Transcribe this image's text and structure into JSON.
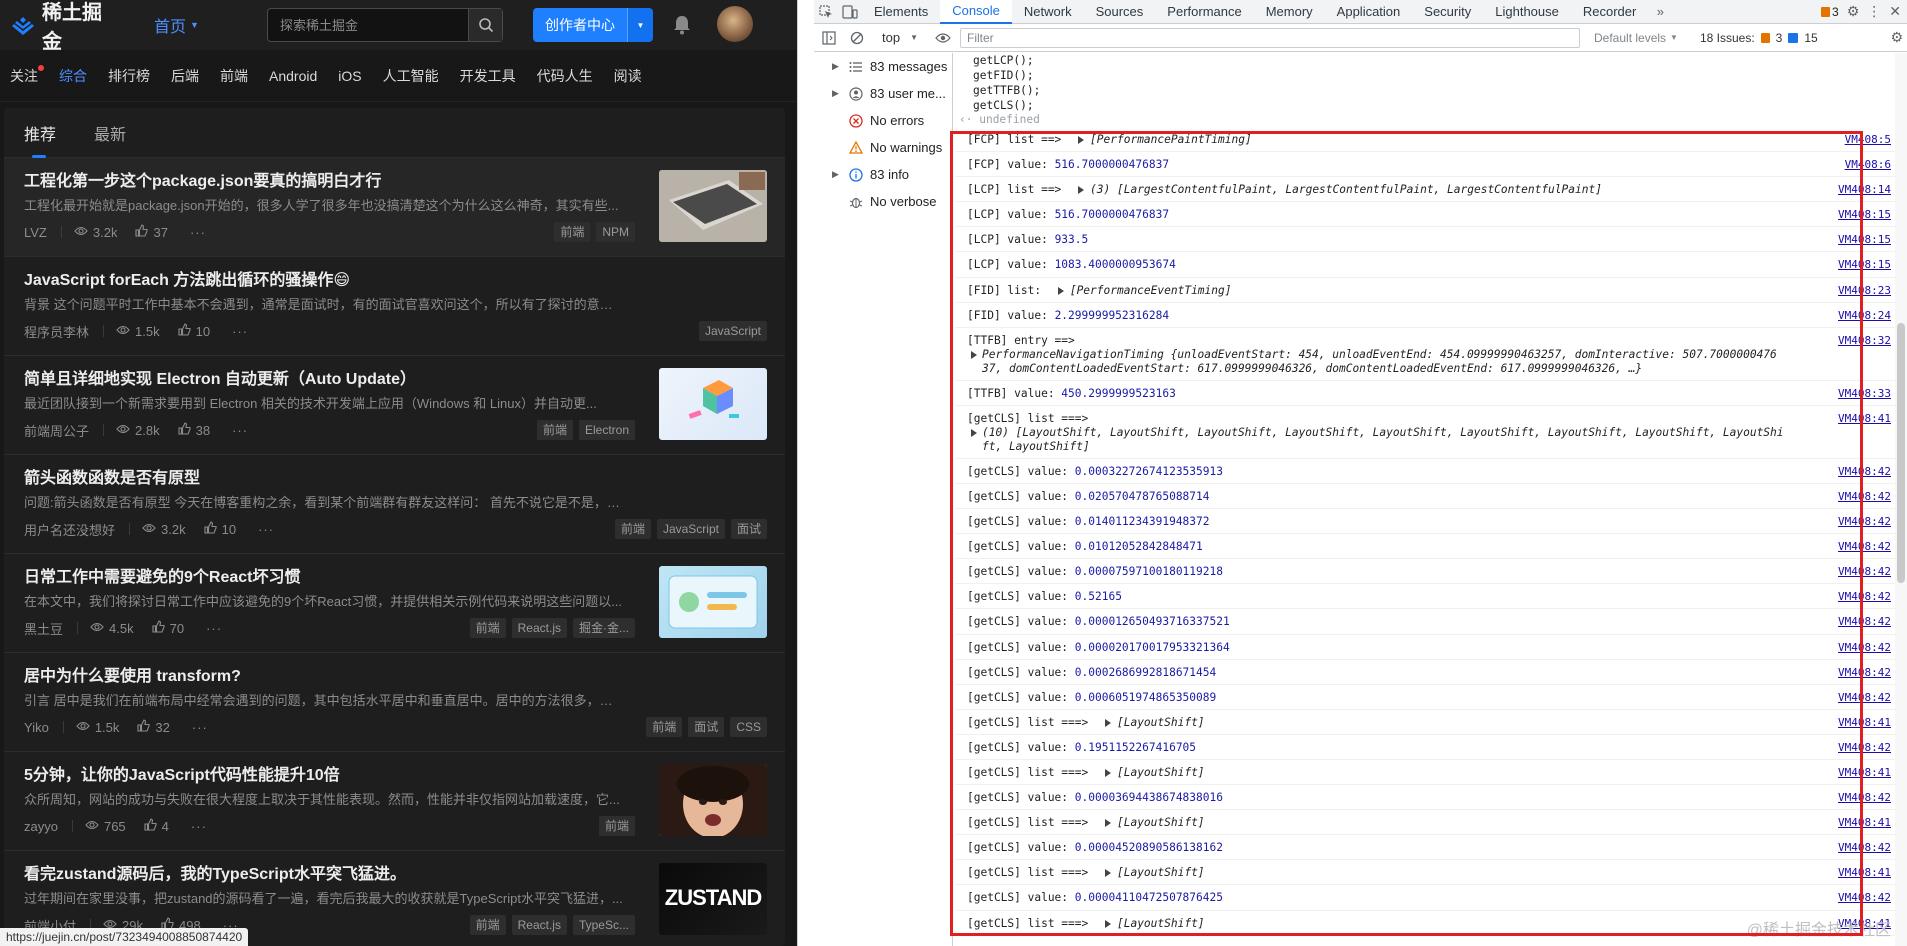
{
  "juejin": {
    "logo_text": "稀土掘金",
    "home_label": "首页",
    "search_placeholder": "探索稀土掘金",
    "creator_label": "创作者中心",
    "categories": [
      "关注",
      "综合",
      "排行榜",
      "后端",
      "前端",
      "Android",
      "iOS",
      "人工智能",
      "开发工具",
      "代码人生",
      "阅读"
    ],
    "feed_tabs": [
      "推荐",
      "最新"
    ],
    "articles": [
      {
        "title": "工程化第一步这个package.json要真的搞明白才行",
        "desc": "工程化最开始就是package.json开始的，很多人学了很多年也没搞清楚这个为什么这么神奇，其实有些...",
        "author": "LVZ",
        "views": "3.2k",
        "likes": "37",
        "tags": [
          "前端",
          "NPM"
        ],
        "thumb": true
      },
      {
        "title": "JavaScript forEach 方法跳出循环的骚操作😄",
        "desc": "背景 这个问题平时工作中基本不会遇到，通常是面试时，有的面试官喜欢问这个，所以有了探讨的意义。 首先我们来看看 for ...",
        "author": "程序员李林",
        "views": "1.5k",
        "likes": "10",
        "tags": [
          "JavaScript"
        ],
        "thumb": false
      },
      {
        "title": "简单且详细地实现 Electron 自动更新（Auto Update）",
        "desc": "最近团队接到一个新需求要用到 Electron 相关的技术开发端上应用（Windows 和 Linux）并自动更...",
        "author": "前端周公子",
        "views": "2.8k",
        "likes": "38",
        "tags": [
          "前端",
          "Electron"
        ],
        "thumb": true
      },
      {
        "title": "箭头函数函数是否有原型",
        "desc": "问题:箭头函数是否有原型 今天在博客重构之余，看到某个前端群有群友这样问： 首先不说它是不是，我们来回顾一下 箭头函数...",
        "author": "用户名还没想好",
        "views": "3.2k",
        "likes": "10",
        "tags": [
          "前端",
          "JavaScript",
          "面试"
        ],
        "thumb": false
      },
      {
        "title": "日常工作中需要避免的9个React坏习惯",
        "desc": "在本文中，我们将探讨日常工作中应该避免的9个坏React习惯，并提供相关示例代码来说明这些问题以...",
        "author": "黑土豆",
        "views": "4.5k",
        "likes": "70",
        "tags": [
          "前端",
          "React.js",
          "掘金·金..."
        ],
        "thumb": true
      },
      {
        "title": "居中为什么要使用 transform?",
        "desc": "引言 居中是我们在前端布局中经常会遇到的问题，其中包括水平居中和垂直居中。居中的方法很多，比如说水平居中可以使用...",
        "author": "Yiko",
        "views": "1.5k",
        "likes": "32",
        "tags": [
          "前端",
          "面试",
          "CSS"
        ],
        "thumb": false
      },
      {
        "title": "5分钟，让你的JavaScript代码性能提升10倍",
        "desc": "众所周知，网站的成功与失败在很大程度上取决于其性能表现。然而，性能并非仅指网站加载速度，它...",
        "author": "zayyo",
        "views": "765",
        "likes": "4",
        "tags": [
          "前端"
        ],
        "thumb": true
      },
      {
        "title": "看完zustand源码后，我的TypeScript水平突飞猛进。",
        "desc": "过年期间在家里没事，把zustand的源码看了一遍，看完后我最大的收获就是TypeScript水平突飞猛进，...",
        "author": "前端小付",
        "views": "29k",
        "likes": "498",
        "tags": [
          "前端",
          "React.js",
          "TypeSc..."
        ],
        "thumb": true,
        "thumb_text": "ZUSTAND"
      }
    ],
    "status_url": "https://juejin.cn/post/7323494008850874420"
  },
  "devtools": {
    "tabs": [
      "Elements",
      "Console",
      "Network",
      "Sources",
      "Performance",
      "Memory",
      "Application",
      "Security",
      "Lighthouse",
      "Recorder"
    ],
    "active_tab": "Console",
    "warn_badge": "3",
    "context": "top",
    "filter_placeholder": "Filter",
    "levels_label": "Default levels",
    "issues_label": "18 Issues:",
    "issues_warn": "3",
    "issues_info": "15",
    "sidebar": [
      {
        "label": "83 messages",
        "icon": "list-icon"
      },
      {
        "label": "83 user me...",
        "icon": "user-icon"
      },
      {
        "label": "No errors",
        "icon": "error-icon"
      },
      {
        "label": "No warnings",
        "icon": "warning-icon"
      },
      {
        "label": "83 info",
        "icon": "info-icon"
      },
      {
        "label": "No verbose",
        "icon": "bug-icon"
      }
    ],
    "pre_lines": [
      "getLCP();",
      "getFID();",
      "getTTFB();",
      "getCLS();"
    ],
    "undefined_line": "undefined",
    "logs": [
      {
        "prefix": "[FCP] list ==> ",
        "obj": "[PerformancePaintTiming]",
        "src": "VM408:5",
        "type": "obj"
      },
      {
        "prefix": "[FCP] value: ",
        "val": "516.7000000476837",
        "src": "VM408:6",
        "type": "num"
      },
      {
        "prefix": "[LCP] list ==> ",
        "obj": "(3) [LargestContentfulPaint, LargestContentfulPaint, LargestContentfulPaint]",
        "src": "VM408:14",
        "type": "obj"
      },
      {
        "prefix": "[LCP] value: ",
        "val": "516.7000000476837",
        "src": "VM408:15",
        "type": "num"
      },
      {
        "prefix": "[LCP] value: ",
        "val": "933.5",
        "src": "VM408:15",
        "type": "num"
      },
      {
        "prefix": "[LCP] value: ",
        "val": "1083.4000000953674",
        "src": "VM408:15",
        "type": "num"
      },
      {
        "prefix": "[FID] list: ",
        "obj": "[PerformanceEventTiming]",
        "src": "VM408:23",
        "type": "obj"
      },
      {
        "prefix": "[FID] value: ",
        "val": "2.299999952316284",
        "src": "VM408:24",
        "type": "num"
      },
      {
        "prefix": "[TTFB] entry ==>",
        "src": "VM408:32",
        "type": "ttfb",
        "line2": "PerformanceNavigationTiming {unloadEventStart: 454, unloadEventEnd: 454.09999990463257, domInteractive: 507.7000000476",
        "line3": "37, domContentLoadedEventStart: 617.0999999046326, domContentLoadedEventEnd: 617.0999999046326, …}"
      },
      {
        "prefix": "[TTFB] value: ",
        "val": "450.2999999523163",
        "src": "VM408:33",
        "type": "num"
      },
      {
        "prefix": "[getCLS] list ===>",
        "src": "VM408:41",
        "type": "cls",
        "line2": "(10) [LayoutShift, LayoutShift, LayoutShift, LayoutShift, LayoutShift, LayoutShift, LayoutShift, LayoutShift, LayoutShi",
        "line3": "ft, LayoutShift]"
      },
      {
        "prefix": "[getCLS] value: ",
        "val": "0.00032272674123535913",
        "src": "VM408:42",
        "type": "num"
      },
      {
        "prefix": "[getCLS] value: ",
        "val": "0.020570478765088714",
        "src": "VM408:42",
        "type": "num"
      },
      {
        "prefix": "[getCLS] value: ",
        "val": "0.014011234391948372",
        "src": "VM408:42",
        "type": "num"
      },
      {
        "prefix": "[getCLS] value: ",
        "val": "0.01012052842848471",
        "src": "VM408:42",
        "type": "num"
      },
      {
        "prefix": "[getCLS] value: ",
        "val": "0.00007597100180119218",
        "src": "VM408:42",
        "type": "num"
      },
      {
        "prefix": "[getCLS] value: ",
        "val": "0.52165",
        "src": "VM408:42",
        "type": "num"
      },
      {
        "prefix": "[getCLS] value: ",
        "val": "0.000012650493716337521",
        "src": "VM408:42",
        "type": "num"
      },
      {
        "prefix": "[getCLS] value: ",
        "val": "0.000020170017953321364",
        "src": "VM408:42",
        "type": "num"
      },
      {
        "prefix": "[getCLS] value: ",
        "val": "0.0002686992818671454",
        "src": "VM408:42",
        "type": "num"
      },
      {
        "prefix": "[getCLS] value: ",
        "val": "0.0006051974865350089",
        "src": "VM408:42",
        "type": "num"
      },
      {
        "prefix": "[getCLS] list ===> ",
        "obj": "[LayoutShift]",
        "src": "VM408:41",
        "type": "obj"
      },
      {
        "prefix": "[getCLS] value: ",
        "val": "0.1951152267416705",
        "src": "VM408:42",
        "type": "num"
      },
      {
        "prefix": "[getCLS] list ===> ",
        "obj": "[LayoutShift]",
        "src": "VM408:41",
        "type": "obj"
      },
      {
        "prefix": "[getCLS] value: ",
        "val": "0.00003694438674838016",
        "src": "VM408:42",
        "type": "num"
      },
      {
        "prefix": "[getCLS] list ===> ",
        "obj": "[LayoutShift]",
        "src": "VM408:41",
        "type": "obj"
      },
      {
        "prefix": "[getCLS] value: ",
        "val": "0.00004520890586138162",
        "src": "VM408:42",
        "type": "num"
      },
      {
        "prefix": "[getCLS] list ===> ",
        "obj": "[LayoutShift]",
        "src": "VM408:41",
        "type": "obj"
      },
      {
        "prefix": "[getCLS] value: ",
        "val": "0.00004110472507876425",
        "src": "VM408:42",
        "type": "num"
      },
      {
        "prefix": "[getCLS] list ===> ",
        "obj": "[LayoutShift]",
        "src": "VM408:41",
        "type": "obj"
      }
    ],
    "watermark": "@稀土掘金技术社区"
  },
  "colors": {
    "accent": "#1e80ff",
    "highlight_box": "#e02020"
  }
}
